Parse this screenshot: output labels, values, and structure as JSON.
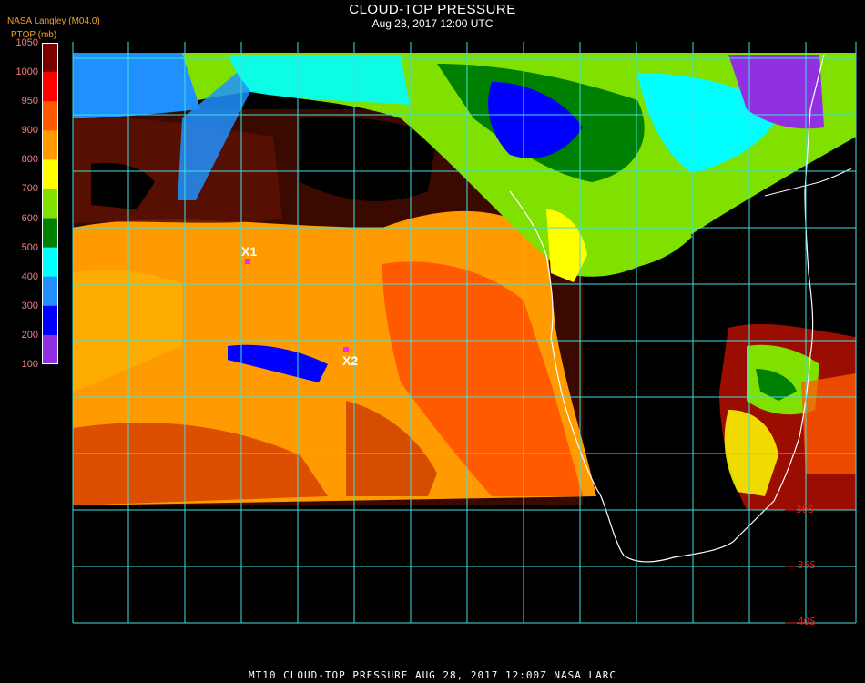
{
  "header": {
    "title": "CLOUD-TOP PRESSURE",
    "subtitle": "Aug 28, 2017 12:00 UTC",
    "brand": "NASA Langley (M04.0)",
    "units": "PTOP (mb)"
  },
  "colorbar": {
    "labels": [
      "1050",
      "1000",
      "950",
      "900",
      "800",
      "700",
      "600",
      "500",
      "400",
      "300",
      "200",
      "100"
    ],
    "colors": [
      "#7a0000",
      "#ff0000",
      "#ff5a00",
      "#ff9a00",
      "#ffff00",
      "#80e000",
      "#008000",
      "#00ffff",
      "#2090ff",
      "#0000ff",
      "#9030e0"
    ]
  },
  "map": {
    "markers": [
      {
        "label": "X1"
      },
      {
        "label": "X2"
      }
    ],
    "lat_labels": [
      "30S",
      "35S",
      "40S"
    ],
    "colors": {
      "grid": "#40e0e0",
      "coast": "#ffffff",
      "lat_label": "#e02020"
    }
  },
  "footer": {
    "text": "MT10  CLOUD-TOP PRESSURE   AUG 28, 2017 12:00Z   NASA LARC"
  }
}
